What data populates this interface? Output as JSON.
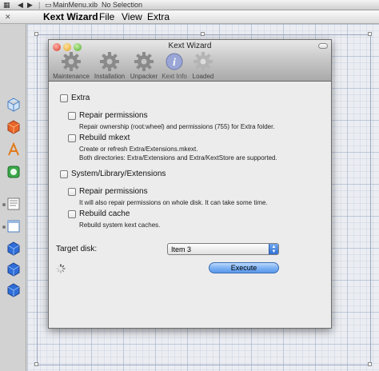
{
  "jumpbar": {
    "file": "MainMenu.xib",
    "selection": "No Selection"
  },
  "menubar": {
    "title": "Kext Wizard",
    "items": [
      "File",
      "View",
      "Extra"
    ]
  },
  "window": {
    "title": "Kext Wizard",
    "toolbar": [
      {
        "label": "Maintenance",
        "icon": "gear-icon"
      },
      {
        "label": "Installation",
        "icon": "gear-icon"
      },
      {
        "label": "Unpacker",
        "icon": "gear-icon"
      },
      {
        "label": "Kext Info",
        "icon": "info-icon"
      },
      {
        "label": "Loaded",
        "icon": "gear-icon"
      }
    ],
    "extra": {
      "label": "Extra",
      "repair_label": "Repair permissions",
      "repair_desc": "Repair ownership (root:wheel) and permissions (755) for Extra folder.",
      "rebuild_label": "Rebuild mkext",
      "rebuild_desc1": "Create or refresh Extra/Extensions.mkext.",
      "rebuild_desc2": "Both directories: Extra/Extensions and Extra/KextStore are supported."
    },
    "sle": {
      "label": "System/Library/Extensions",
      "repair_label": "Repair permissions",
      "repair_desc": "It will also repair permissions on whole disk. It can take some time.",
      "rebuild_label": "Rebuild cache",
      "rebuild_desc": "Rebuild system kext caches."
    },
    "target_disk_label": "Target disk:",
    "target_disk_value": "Item 3",
    "execute_label": "Execute"
  },
  "colors": {
    "accent": "#5a97ea",
    "canvas": "#ebedf2"
  }
}
